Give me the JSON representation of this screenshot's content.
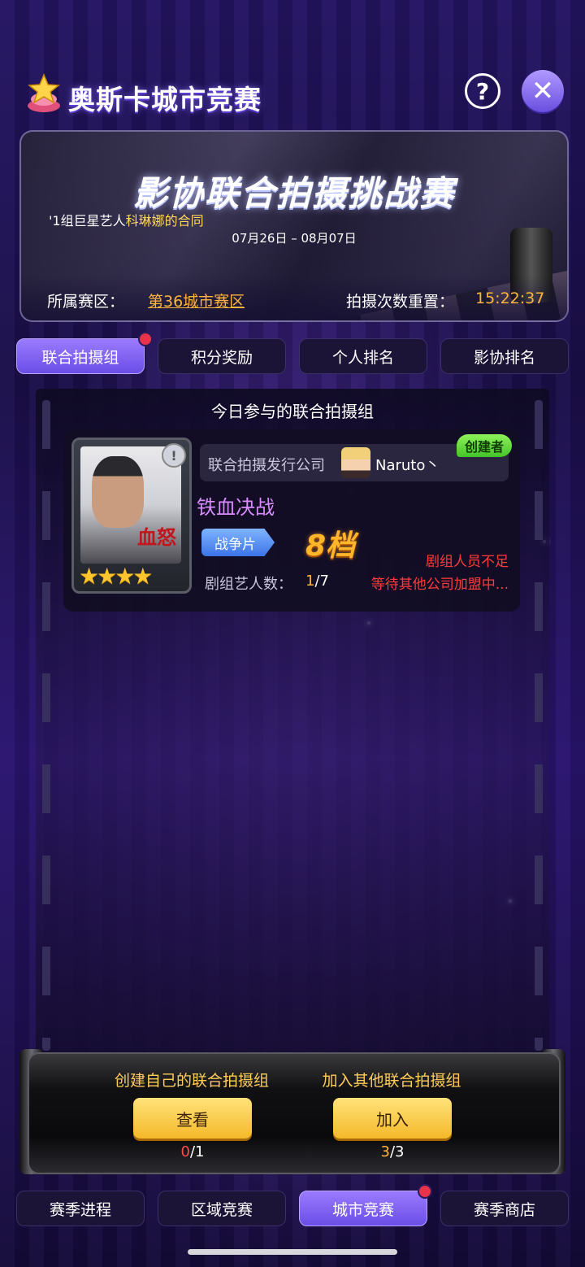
{
  "header": {
    "title": "奥斯卡城市竞赛",
    "help_icon": "?",
    "close_icon": "✕"
  },
  "banner": {
    "title": "影协联合拍摄挑战赛",
    "subtitle_prefix": "'1组巨星艺人",
    "subtitle_highlight": "科琳娜的合同",
    "dates": "07月26日 – 08月07日",
    "region_label": "所属赛区：",
    "region_value": "第36城市赛区",
    "reset_label": "拍摄次数重置：",
    "reset_value": "15:22:37"
  },
  "tabs": [
    {
      "label": "联合拍摄组",
      "active": true,
      "badge": true
    },
    {
      "label": "积分奖励",
      "active": false
    },
    {
      "label": "个人排名",
      "active": false
    },
    {
      "label": "影协排名",
      "active": false
    }
  ],
  "panel": {
    "title": "今日参与的联合拍摄组"
  },
  "card": {
    "poster_text": "血怒",
    "poster_info_icon": "!",
    "stars": "★★★★",
    "company_label": "联合拍摄发行公司",
    "company_user": "Naruto丶",
    "creator_badge": "创建者",
    "movie_title": "铁血决战",
    "genre": "战争片",
    "tier": "8档",
    "crew_label": "剧组艺人数：",
    "crew_current": "1",
    "crew_total": "/7",
    "status_line1": "剧组人员不足",
    "status_line2": "等待其他公司加盟中..."
  },
  "actions": {
    "create_label": "创建自己的联合拍摄组",
    "create_button": "查看",
    "create_count_current": "0",
    "create_count_total": "/1",
    "join_label": "加入其他联合拍摄组",
    "join_button": "加入",
    "join_count_current": "3",
    "join_count_total": "/3"
  },
  "nav": [
    {
      "label": "赛季进程",
      "active": false
    },
    {
      "label": "区域竞赛",
      "active": false
    },
    {
      "label": "城市竞赛",
      "active": true,
      "badge": true
    },
    {
      "label": "赛季商店",
      "active": false
    }
  ],
  "colors": {
    "accent_purple": "#7b5cf0",
    "highlight_orange": "#ffb43a",
    "warning_red": "#ff3b3b",
    "creator_green": "#5ad83a"
  }
}
